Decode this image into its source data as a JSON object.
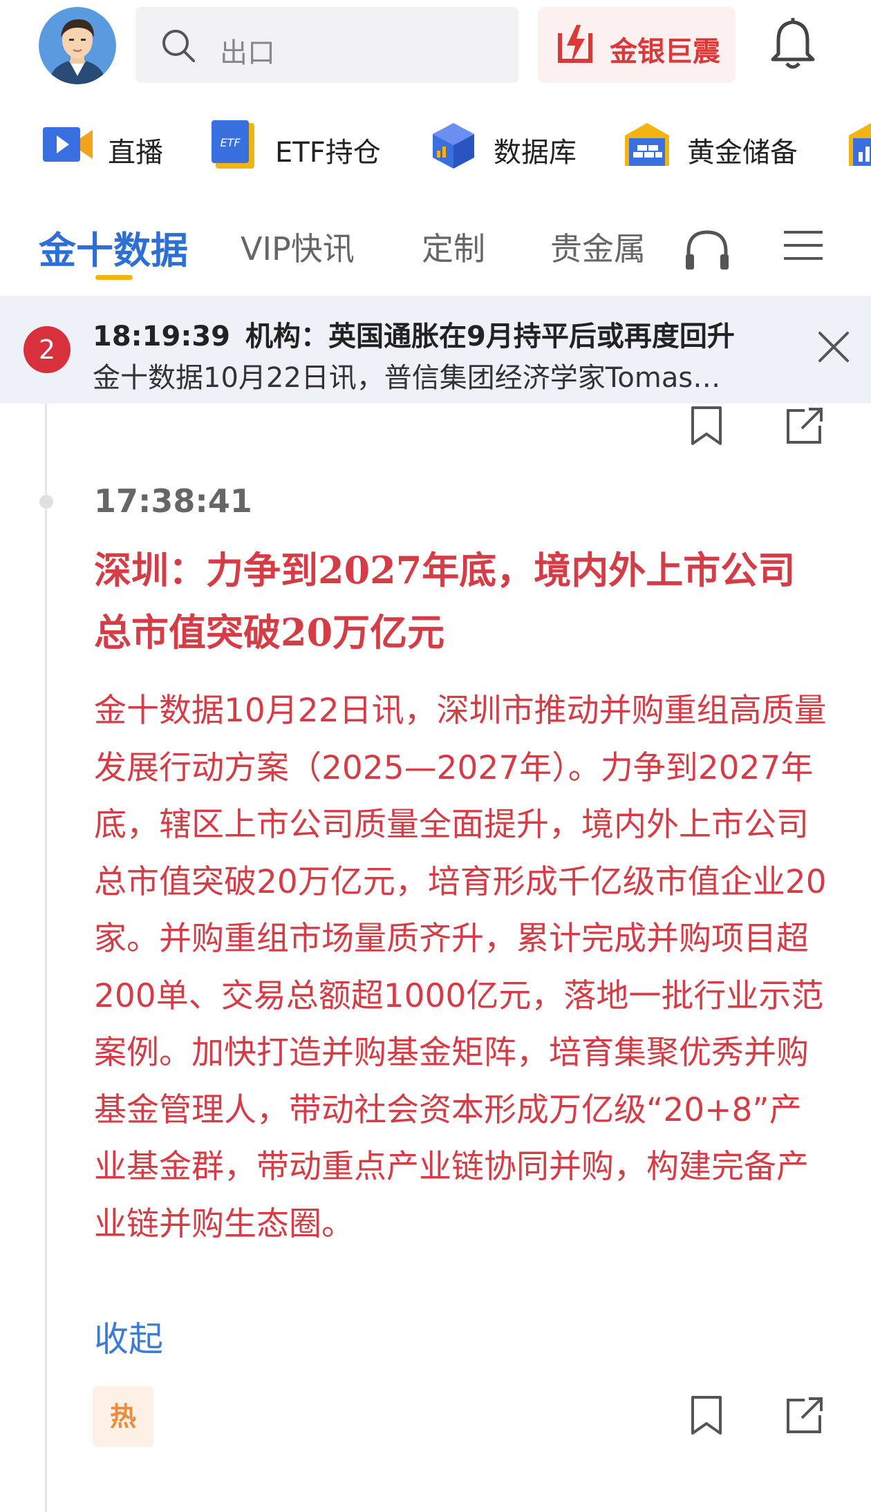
{
  "search": {
    "placeholder": "出口"
  },
  "promo": {
    "label": "金银巨震"
  },
  "shortcuts": [
    {
      "label": "直播",
      "icon": "live-video-icon"
    },
    {
      "label": "ETF持仓",
      "icon": "etf-icon"
    },
    {
      "label": "数据库",
      "icon": "database-icon"
    },
    {
      "label": "黄金储备",
      "icon": "gold-reserve-icon"
    }
  ],
  "tabs": [
    {
      "label": "金十数据",
      "active": true
    },
    {
      "label": "VIP快讯",
      "active": false
    },
    {
      "label": "定制",
      "active": false
    },
    {
      "label": "贵金属",
      "active": false
    }
  ],
  "notice": {
    "count": "2",
    "time": "18:19:39",
    "headline": "机构：英国通胀在9月持平后或再度回升",
    "preview": "金十数据10月22日讯，普信集团经济学家Tomas…"
  },
  "news": {
    "time": "17:38:41",
    "title": "深圳：力争到2027年底，境内外上市公司总市值突破20万亿元",
    "body": "金十数据10月22日讯，深圳市推动并购重组高质量发展行动方案（2025—2027年）。力争到2027年底，辖区上市公司质量全面提升，境内外上市公司总市值突破20万亿元，培育形成千亿级市值企业20家。并购重组市场量质齐升，累计完成并购项目超200单、交易总额超1000亿元，落地一批行业示范案例。加快打造并购基金矩阵，培育集聚优秀并购基金管理人，带动社会资本形成万亿级“20+8”产业基金群，带动重点产业链协同并购，构建完备产业链并购生态圈。",
    "collapse_label": "收起",
    "hot_label": "热"
  },
  "colors": {
    "accent": "#2e6fd6",
    "headline_red": "#d43d46",
    "tab_underline": "#f2b410",
    "badge_red": "#d8303c",
    "notice_bg": "#eef1f8"
  }
}
